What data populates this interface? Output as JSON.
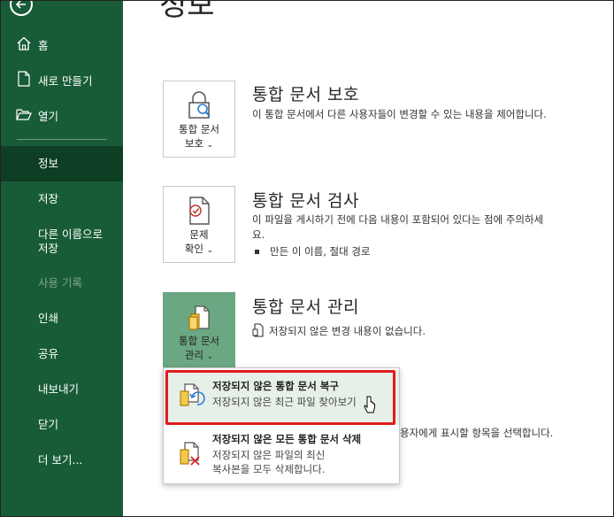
{
  "sidebar": {
    "back_icon": "back-arrow-icon",
    "items": [
      {
        "label": "홈",
        "icon": "home-icon"
      },
      {
        "label": "새로 만들기",
        "icon": "new-file-icon"
      },
      {
        "label": "열기",
        "icon": "folder-open-icon"
      },
      {
        "label": "정보"
      },
      {
        "label": "저장"
      },
      {
        "label": "다른 이름으로 저장"
      },
      {
        "label": "사용 기록"
      },
      {
        "label": "인쇄"
      },
      {
        "label": "공유"
      },
      {
        "label": "내보내기"
      },
      {
        "label": "닫기"
      },
      {
        "label": "더 보기..."
      }
    ],
    "item6_line1": "다른 이름으로",
    "item6_line2": "저장",
    "bg_color": "#185c37",
    "active_color": "#0e3e24"
  },
  "main": {
    "title": "정보",
    "sections": [
      {
        "tile_line1": "통합 문서",
        "tile_line2": "보호",
        "tile_icon": "lock-search-icon",
        "title": "통합 문서 보호",
        "desc": "이 통합 문서에서 다른 사용자들이 변경할 수 있는 내용을 제어합니다."
      },
      {
        "tile_line1": "문제",
        "tile_line2": "확인",
        "tile_icon": "document-check-icon",
        "title": "통합 문서 검사",
        "desc_line1": "이 파일을 게시하기 전에 다음 내용이 포함되어 있다는 점에 주의하세",
        "desc_line2": "요.",
        "bullet": "만든 이 이름, 절대 경로"
      },
      {
        "tile_line1": "통합 문서",
        "tile_line2": "관리",
        "tile_icon": "manage-workbook-icon",
        "title": "통합 문서 관리",
        "desc": "저장되지 않은 변경 내용이 없습니다.",
        "desc_icon": "document-small-icon",
        "hidden_desc": "용자에게 표시할 항목을 선택합니다."
      }
    ]
  },
  "dropdown": {
    "items": [
      {
        "title": "저장되지 않은 통합 문서 복구",
        "desc": "저장되지 않은 최근 파일 찾아보기",
        "icon": "recover-document-icon"
      },
      {
        "title": "저장되지 않은 모든 통합 문서 삭제",
        "desc_line1": "저장되지 않은 파일의 최신",
        "desc_line2": "복사본을 모두 삭제합니다.",
        "icon": "delete-document-icon"
      }
    ],
    "highlight_color": "#e21b1b"
  }
}
